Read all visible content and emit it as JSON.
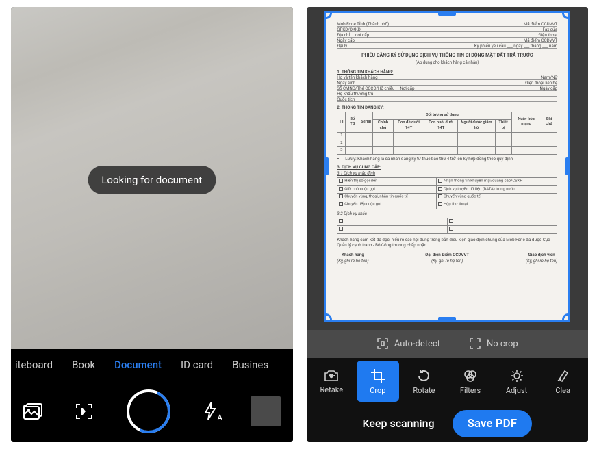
{
  "left": {
    "toast": "Looking for document",
    "modes": [
      "iteboard",
      "Book",
      "Document",
      "ID card",
      "Busines"
    ],
    "active_mode_index": 2,
    "flash_label": "A"
  },
  "right": {
    "detect": {
      "auto": "Auto-detect",
      "nocrop": "No crop"
    },
    "tools": {
      "retake": "Retake",
      "crop": "Crop",
      "rotate": "Rotate",
      "filters": "Filters",
      "adjust": "Adjust",
      "clean": "Clea"
    },
    "keep": "Keep scanning",
    "save": "Save PDF",
    "doc": {
      "header_row1": [
        "MobiFone Tỉnh (Thành phố)",
        "Mã điểm CCDVVT"
      ],
      "header_row2": [
        "GPKD/ĐKKD",
        "Fax cửa"
      ],
      "header_row3": [
        "Địa chỉ",
        "nơi cấp",
        "Điện thoại"
      ],
      "header_row4": [
        "Ngày cấp",
        "Mã điểm CCDVVT"
      ],
      "header_row5": [
        "Đại lý",
        "Ký phiếu yêu cầu",
        "ngày",
        "tháng",
        "năm"
      ],
      "title": "PHIẾU ĐĂNG KÝ SỬ DỤNG DỊCH VỤ THÔNG TIN DI ĐỘNG MẶT ĐẤT TRẢ TRƯỚC",
      "subtitle": "(Áp dụng cho khách hàng cá nhân)",
      "sec1": "1. THÔNG TIN KHÁCH HÀNG:",
      "r11": [
        "Họ và tên khách hàng",
        "Nam/Nữ"
      ],
      "r12": [
        "Ngày sinh",
        "Điện thoại liên hệ"
      ],
      "r13": [
        "Số CMND/Thẻ CCCD/Hộ chiếu",
        "Nơi cấp",
        "Ngày cấp"
      ],
      "r14": "Hộ khẩu thường trú",
      "r15": "Quốc tịch",
      "sec2": "2. THÔNG TIN ĐĂNG KÝ:",
      "tbl2_group": "Đối tượng sử dụng",
      "tbl2_head": [
        "TT",
        "Số TB",
        "Serial",
        "Chính chủ",
        "Con đẻ dưới 14T",
        "Con nuôi dưới 14T",
        "Người được giám hộ",
        "Thiết bị",
        "Ngày hòa mạng",
        "Ghi chú"
      ],
      "tbl2_rows": [
        "1",
        "2",
        "3"
      ],
      "note2": "Lưu ý: Khách hàng là cá nhân đăng ký từ thuê bao thứ 4 trở lên ký hợp đồng theo quy định",
      "sec3": "3. DỊCH VỤ CUNG CẤP:",
      "sec31": "3.1 Dịch vụ mặc định",
      "svc": [
        [
          "Hiển thị số gọi đến",
          "Nhận thông tin khuyến mại/quảng cáo/CSKH"
        ],
        [
          "Giữ, chờ cuộc gọi",
          "Dịch vụ truyền dữ liệu (DATA) trong nước"
        ],
        [
          "Chuyển vùng, thoại, nhắn tin quốc tế",
          "Chuyển vùng quốc tế"
        ],
        [
          "Chuyển tiếp cuộc gọi",
          "Hộp thư thoại"
        ]
      ],
      "sec32": "3.2 Dịch vụ khác",
      "commit": "Khách hàng cam kết đã đọc, hiểu rõ các nội dung trong bản điều kiện giao dịch chung của MobiFone đã được Cục Quản lý cạnh tranh - Bộ Công thương chấp nhận.",
      "sign": [
        "Khách hàng",
        "Đại diện Điểm CCDVVT",
        "Giao dịch viên"
      ],
      "sign_note": "(Ký, ghi rõ họ tên)"
    }
  }
}
